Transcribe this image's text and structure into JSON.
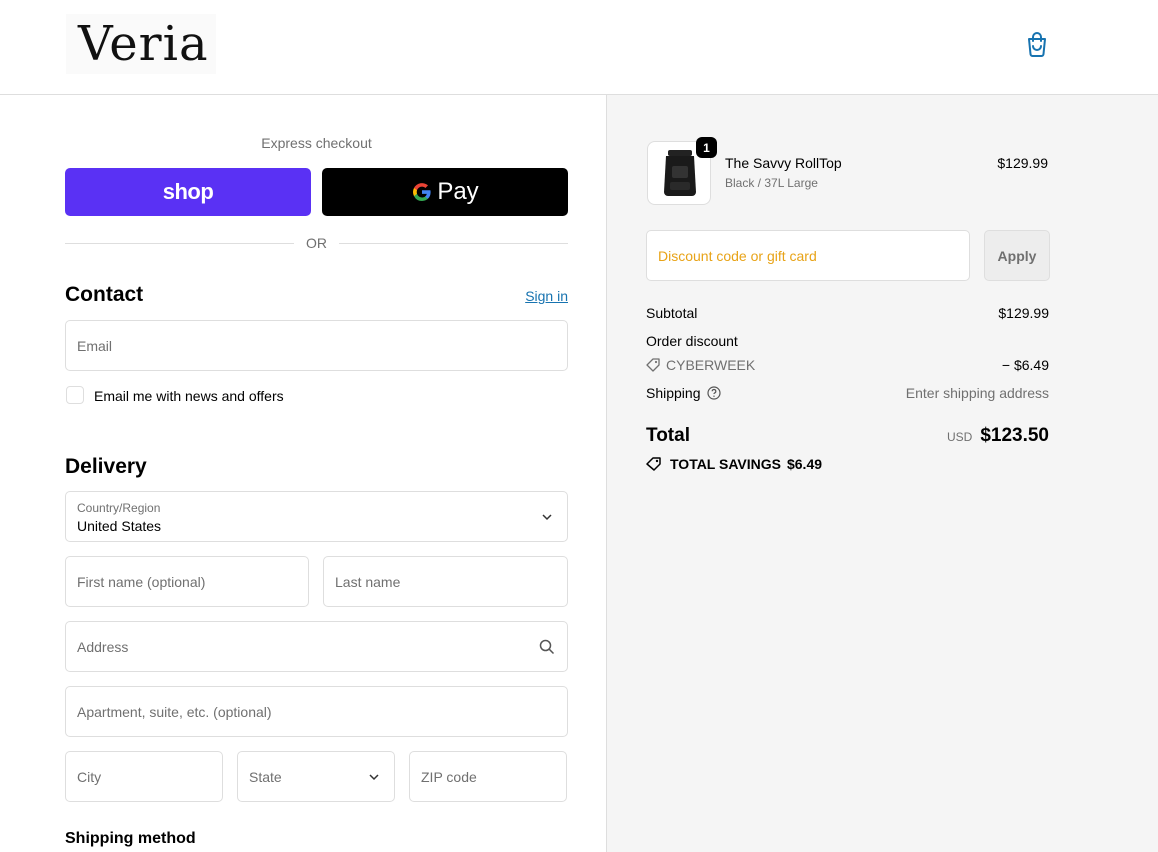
{
  "header": {
    "logo_text": "Veria",
    "cart_icon": "shopping-bag-icon",
    "accent_color": "#1773b0"
  },
  "express": {
    "label": "Express checkout",
    "shop_pay_label": "shop",
    "shop_pay_color": "#5a31f4",
    "gpay_label": "Pay",
    "or_label": "OR"
  },
  "contact": {
    "title": "Contact",
    "sign_in": "Sign in",
    "email_placeholder": "Email",
    "newsletter_label": "Email me with news and offers"
  },
  "delivery": {
    "title": "Delivery",
    "country_label": "Country/Region",
    "country_value": "United States",
    "first_name_placeholder": "First name (optional)",
    "last_name_placeholder": "Last name",
    "address_placeholder": "Address",
    "apartment_placeholder": "Apartment, suite, etc. (optional)",
    "city_placeholder": "City",
    "state_placeholder": "State",
    "zip_placeholder": "ZIP code",
    "shipping_method_title": "Shipping method"
  },
  "summary": {
    "item": {
      "name": "The Savvy RollTop",
      "variant": "Black / 37L Large",
      "price": "$129.99",
      "quantity": "1"
    },
    "discount_placeholder": "Discount code or gift card",
    "apply_label": "Apply",
    "subtotal_label": "Subtotal",
    "subtotal_value": "$129.99",
    "order_discount_label": "Order discount",
    "discount_code": "CYBERWEEK",
    "discount_value": "− $6.49",
    "shipping_label": "Shipping",
    "shipping_value": "Enter shipping address",
    "total_label": "Total",
    "currency": "USD",
    "total_value": "$123.50",
    "savings_label": "TOTAL SAVINGS",
    "savings_value": "$6.49"
  }
}
